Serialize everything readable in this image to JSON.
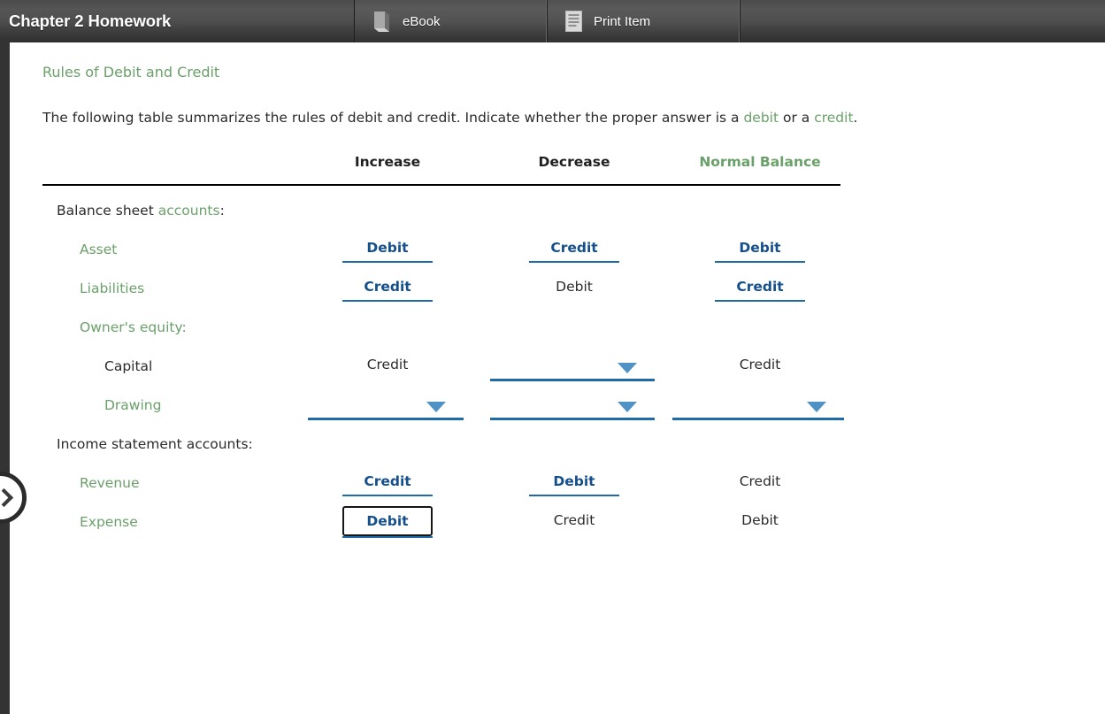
{
  "topbar": {
    "title": "Chapter 2 Homework",
    "buttons": [
      {
        "label": "eBook",
        "icon": "book-icon"
      },
      {
        "label": "Print Item",
        "icon": "document-icon"
      }
    ]
  },
  "rail": {
    "toggle_icon": "chevron-right-icon"
  },
  "question": {
    "title": "Rules of Debit and Credit",
    "instruction_part1": "The following table summarizes the rules of debit and credit. Indicate whether the proper answer is a ",
    "instruction_kw1": "debit",
    "instruction_part2": " or a ",
    "instruction_kw2": "credit",
    "instruction_part3": "."
  },
  "table": {
    "headers": [
      {
        "label": "Increase",
        "style": "dark"
      },
      {
        "label": "Decrease",
        "style": "dark"
      },
      {
        "label": "Normal Balance",
        "style": "green"
      }
    ],
    "rows": [
      {
        "label_dark": "Balance sheet ",
        "label_green": "accounts",
        "label_tail": ":",
        "indent": 0,
        "cells": []
      },
      {
        "label": "Asset",
        "label_style": "green",
        "indent": 1,
        "cells": [
          {
            "type": "answer",
            "value": "Debit"
          },
          {
            "type": "answer",
            "value": "Credit"
          },
          {
            "type": "answer",
            "value": "Debit"
          }
        ]
      },
      {
        "label": "Liabilities",
        "label_style": "green",
        "indent": 1,
        "cells": [
          {
            "type": "answer",
            "value": "Credit"
          },
          {
            "type": "static",
            "value": "Debit"
          },
          {
            "type": "answer",
            "value": "Credit"
          }
        ]
      },
      {
        "label": "Owner's equity:",
        "label_style": "green",
        "indent": 1,
        "cells": []
      },
      {
        "label": "Capital",
        "label_style": "dark",
        "indent": 2,
        "cells": [
          {
            "type": "static",
            "value": "Credit"
          },
          {
            "type": "dropdown",
            "value": ""
          },
          {
            "type": "static",
            "value": "Credit"
          }
        ]
      },
      {
        "label": "Drawing",
        "label_style": "green",
        "indent": 2,
        "cells": [
          {
            "type": "dropdown",
            "value": ""
          },
          {
            "type": "dropdown",
            "value": ""
          },
          {
            "type": "dropdown",
            "value": ""
          }
        ]
      },
      {
        "label": "Income statement accounts:",
        "label_style": "dark",
        "indent": 0,
        "cells": []
      },
      {
        "label": "Revenue",
        "label_style": "green",
        "indent": 1,
        "cells": [
          {
            "type": "answer",
            "value": "Credit"
          },
          {
            "type": "answer",
            "value": "Debit"
          },
          {
            "type": "static",
            "value": "Credit"
          }
        ]
      },
      {
        "label": "Expense",
        "label_style": "green",
        "indent": 1,
        "cells": [
          {
            "type": "answer-focused",
            "value": "Debit"
          },
          {
            "type": "static",
            "value": "Credit"
          },
          {
            "type": "static",
            "value": "Debit"
          }
        ]
      }
    ]
  },
  "colors": {
    "green": "#6aa06a",
    "answer_blue": "#15508c",
    "underline_blue": "#1f6ba8",
    "caret_blue": "#4f92c6",
    "topbar_dark": "#444444",
    "rail_dark": "#333333"
  }
}
